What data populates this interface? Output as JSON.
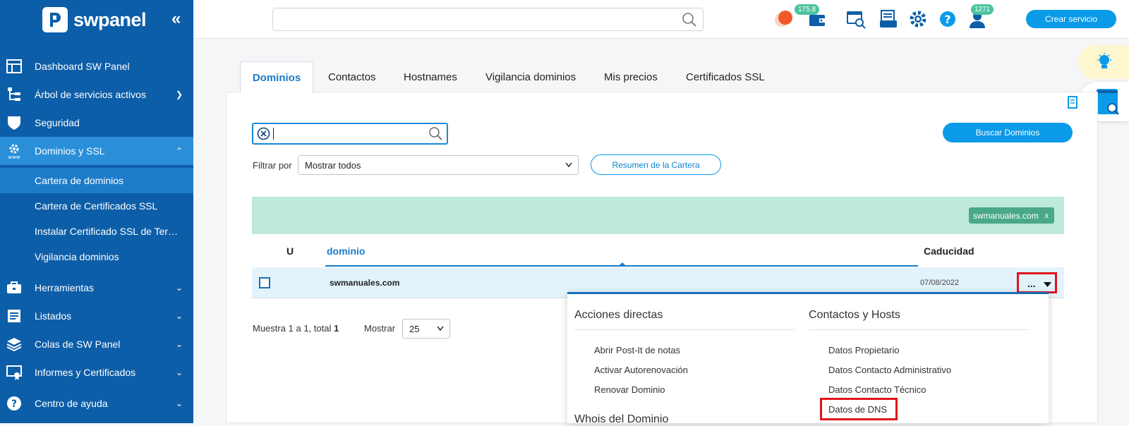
{
  "brand": {
    "name": "swpanel"
  },
  "sidebar": {
    "items": [
      {
        "label": "Dashboard SW Panel"
      },
      {
        "label": "Árbol de servicios activos"
      },
      {
        "label": "Seguridad"
      },
      {
        "label": "Dominios y SSL"
      },
      {
        "label": "Herramientas"
      },
      {
        "label": "Listados"
      },
      {
        "label": "Colas de SW Panel"
      },
      {
        "label": "Informes y Certificados"
      },
      {
        "label": "Centro de ayuda"
      }
    ],
    "subitems": [
      {
        "label": "Cartera de dominios"
      },
      {
        "label": "Cartera de Certificados SSL"
      },
      {
        "label": "Instalar Certificado SSL de Ter…"
      },
      {
        "label": "Vigilancia dominios"
      }
    ]
  },
  "topbar": {
    "wallet_badge": "175.8",
    "user_badge": "1271",
    "create_label": "Crear servicio"
  },
  "tabs": [
    {
      "label": "Dominios"
    },
    {
      "label": "Contactos"
    },
    {
      "label": "Hostnames"
    },
    {
      "label": "Vigilancia dominios"
    },
    {
      "label": "Mis precios"
    },
    {
      "label": "Certificados SSL"
    }
  ],
  "filters": {
    "search_button": "Buscar Dominios",
    "filter_label": "Filtrar por",
    "filter_value": "Mostrar todos",
    "summary_button": "Resumen de la Cartera",
    "chip": "swmanuales.com",
    "chip_close": "x"
  },
  "table": {
    "headers": {
      "u": "U",
      "domain": "dominio",
      "expiry": "Caducidad"
    },
    "rows": [
      {
        "domain": "swmanuales.com",
        "expiry": "07/08/2022",
        "actions": "..."
      }
    ]
  },
  "pager": {
    "prefix": "Muestra",
    "from": "1",
    "to_word": "a",
    "to": "1",
    "total_label": ", total",
    "total": "1",
    "show_label": "Mostrar",
    "page_size": "25"
  },
  "dropdown": {
    "direct_title": "Acciones directas",
    "direct_items": [
      "Abrir Post-It de notas",
      "Activar Autorenovación",
      "Renovar Dominio"
    ],
    "whois_title": "Whois del Dominio",
    "contacts_title": "Contactos y Hosts",
    "contact_items": [
      "Datos Propietario",
      "Datos Contacto Administrativo",
      "Datos Contacto Técnico",
      "Datos de DNS"
    ]
  },
  "colors": {
    "sidebar": "#0d5ea8",
    "accent": "#0b9ae8",
    "active": "#2a8fd8",
    "highlight": "#e0141b"
  }
}
